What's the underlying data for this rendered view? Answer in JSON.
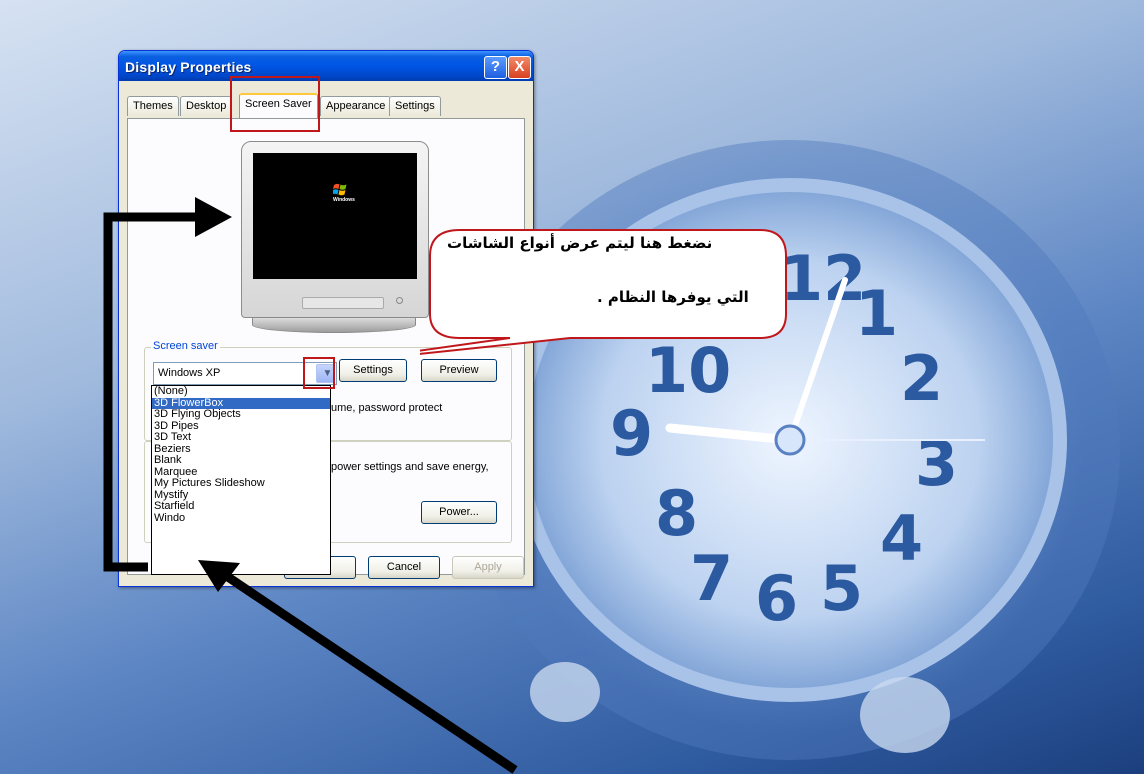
{
  "window": {
    "title": "Display Properties",
    "help_label": "?",
    "close_label": "X"
  },
  "tabs": [
    {
      "label": "Themes"
    },
    {
      "label": "Desktop"
    },
    {
      "label": "Screen Saver",
      "active": true
    },
    {
      "label": "Appearance"
    },
    {
      "label": "Settings"
    }
  ],
  "screen_saver": {
    "group_label": "Screen saver",
    "selected": "Windows XP",
    "settings_label": "Settings",
    "preview_label": "Preview",
    "resume_text": "ume, password protect",
    "power_text": "power settings and save energy,",
    "power_label": "Power...",
    "options": [
      "(None)",
      "3D FlowerBox",
      "3D Flying Objects",
      "3D Pipes",
      "3D Text",
      "Beziers",
      "Blank",
      "Marquee",
      "My Pictures Slideshow",
      "Mystify",
      "Starfield",
      "Windo"
    ],
    "highlighted_option": "3D FlowerBox"
  },
  "footer": {
    "cancel_label": "Cancel",
    "apply_label": "Apply"
  },
  "monitor": {
    "logo_text": "Windows"
  },
  "callout": {
    "line1": "نضغط هنا ليتم عرض أنواع الشاشات",
    "line2": "التي يوفرها النظام ."
  },
  "colors": {
    "title_bar": "#0055e5",
    "selection": "#316ac5",
    "highlight_box": "#c0171b"
  }
}
